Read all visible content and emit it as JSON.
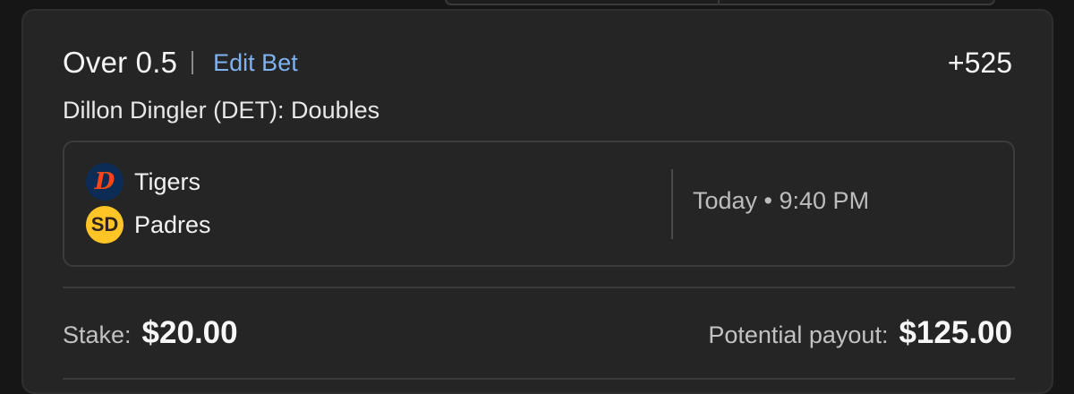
{
  "bet": {
    "selection": "Over 0.5",
    "edit_label": "Edit Bet",
    "odds": "+525",
    "market": "Dillon Dingler (DET): Doubles"
  },
  "game": {
    "teams": [
      {
        "name": "Tigers",
        "logo_text": "D",
        "logo_icon": "tigers-logo-icon",
        "color_bg": "#0c2c56",
        "color_fg": "#fa4616"
      },
      {
        "name": "Padres",
        "logo_text": "SD",
        "logo_icon": "padres-logo-icon",
        "color_bg": "#ffc425",
        "color_fg": "#2f241d"
      }
    ],
    "time": "Today • 9:40 PM"
  },
  "wager": {
    "stake_label": "Stake:",
    "stake_value": "$20.00",
    "payout_label": "Potential payout:",
    "payout_value": "$125.00"
  },
  "colors": {
    "accent_link": "#7fb2f0",
    "card_bg": "#252525",
    "page_bg": "#161616"
  }
}
